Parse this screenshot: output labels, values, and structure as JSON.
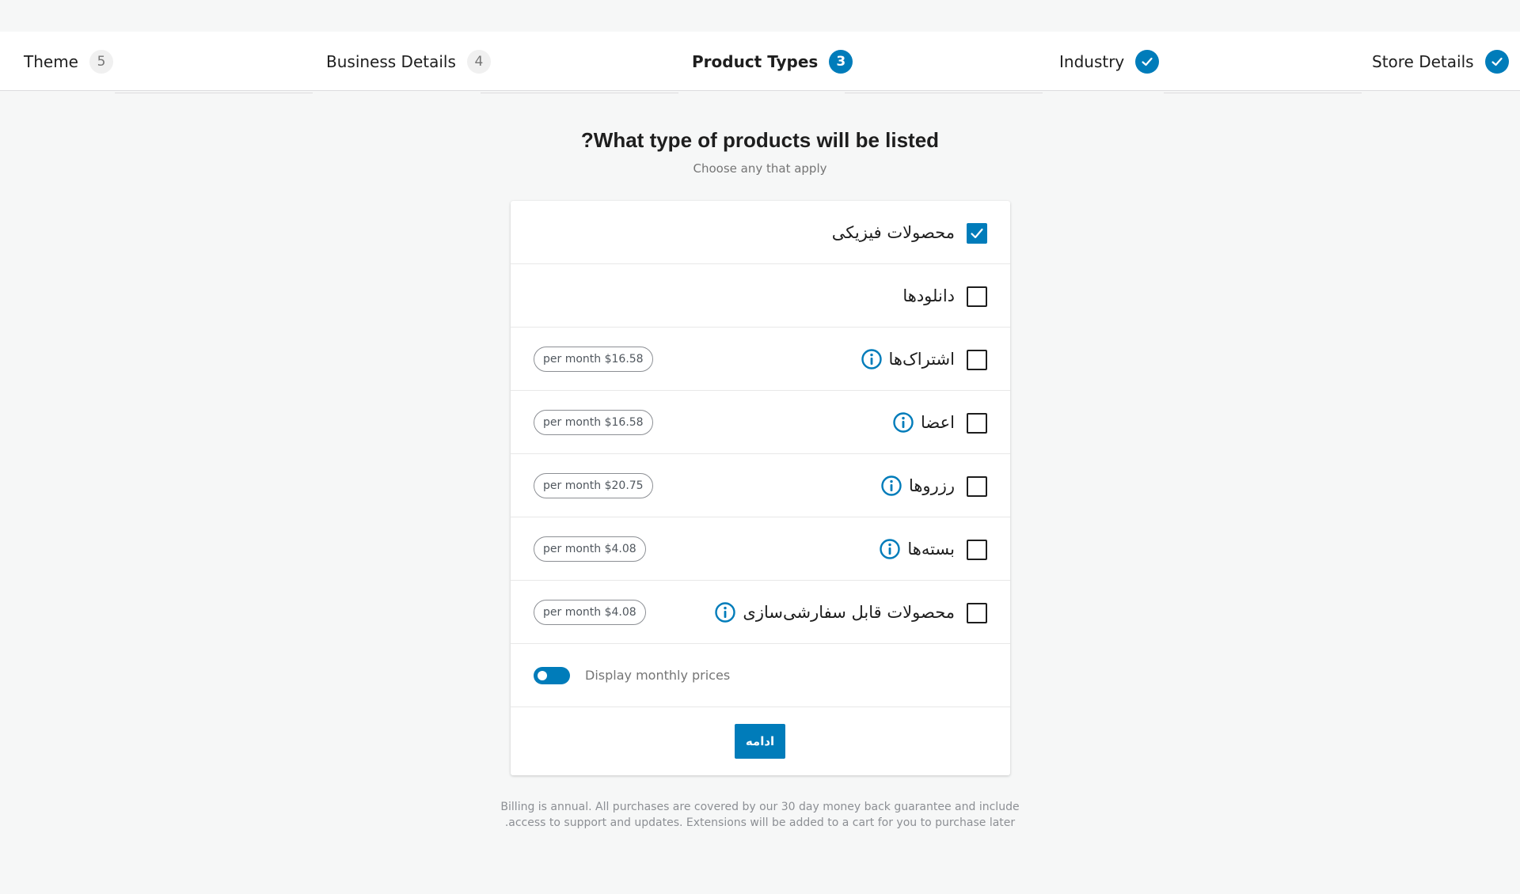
{
  "stepper": {
    "steps": [
      {
        "label": "Theme",
        "badge": "5",
        "state": "upcoming"
      },
      {
        "label": "Business Details",
        "badge": "4",
        "state": "upcoming"
      },
      {
        "label": "Product Types",
        "badge": "3",
        "state": "current"
      },
      {
        "label": "Industry",
        "badge": "",
        "state": "complete"
      },
      {
        "label": "Store Details",
        "badge": "",
        "state": "complete"
      }
    ]
  },
  "header": {
    "title": "?What type of products will be listed",
    "subtitle": "Choose any that apply"
  },
  "product_types": [
    {
      "label": "محصولات فیزیکی",
      "checked": true,
      "info": false,
      "price": ""
    },
    {
      "label": "دانلودها",
      "checked": false,
      "info": false,
      "price": ""
    },
    {
      "label": "اشتراک‌ها",
      "checked": false,
      "info": true,
      "price": "per month $16.58"
    },
    {
      "label": "اعضا",
      "checked": false,
      "info": true,
      "price": "per month $16.58"
    },
    {
      "label": "رزروها",
      "checked": false,
      "info": true,
      "price": "per month $20.75"
    },
    {
      "label": "بسته‌ها",
      "checked": false,
      "info": true,
      "price": "per month $4.08"
    },
    {
      "label": "محصولات قابل سفارشی‌سازی",
      "checked": false,
      "info": true,
      "price": "per month $4.08"
    }
  ],
  "toggle": {
    "label": "Display monthly prices",
    "on": true
  },
  "continue_button": {
    "label": "ادامه"
  },
  "footnote": {
    "line1": "Billing is annual. All purchases are covered by our 30 day money back guarantee and include",
    "line2": ".access to support and updates. Extensions will be added to a cart for you to purchase later"
  },
  "colors": {
    "accent": "#007cba",
    "background": "#f6f7f7"
  },
  "icons": {
    "complete": "checkmark-icon",
    "info": "info-icon",
    "checkbox_checked": "checkbox-checked-icon"
  }
}
